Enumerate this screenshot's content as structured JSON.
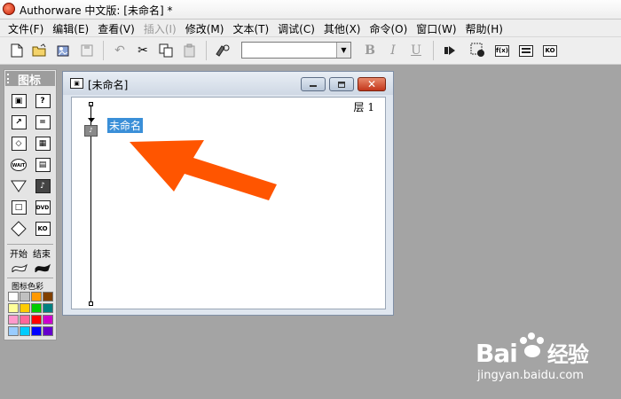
{
  "app": {
    "title": "Authorware 中文版: [未命名] *"
  },
  "menu": [
    {
      "label": "文件(F)",
      "disabled": false
    },
    {
      "label": "编辑(E)",
      "disabled": false
    },
    {
      "label": "查看(V)",
      "disabled": false
    },
    {
      "label": "插入(I)",
      "disabled": true
    },
    {
      "label": "修改(M)",
      "disabled": false
    },
    {
      "label": "文本(T)",
      "disabled": false
    },
    {
      "label": "调试(C)",
      "disabled": false
    },
    {
      "label": "其他(X)",
      "disabled": false
    },
    {
      "label": "命令(O)",
      "disabled": false
    },
    {
      "label": "窗口(W)",
      "disabled": false
    },
    {
      "label": "帮助(H)",
      "disabled": false
    }
  ],
  "toolbar": {
    "font_value": "",
    "bold": "B",
    "italic": "I",
    "underline": "U",
    "func_label": "f(x)",
    "ko_label": "KO"
  },
  "palette": {
    "title": "图标",
    "start_label": "开始",
    "end_label": "结束",
    "color_label": "图标色彩",
    "icons": [
      "display-icon",
      "interaction-icon",
      "motion-icon",
      "calculation-icon",
      "erase-icon",
      "map-icon",
      "wait-icon",
      "movie-icon",
      "navigate-icon",
      "sound-icon",
      "framework-icon",
      "video-icon",
      "decision-icon",
      "knowledge-object-icon"
    ],
    "wait_text": "WAIT",
    "dvd_text": "DVD",
    "ko_text": "KO",
    "colors": [
      "#ffffff",
      "#c0c0c0",
      "#ff9900",
      "#804000",
      "#ffff99",
      "#ffcc00",
      "#00cc00",
      "#008080",
      "#ff99cc",
      "#ff6699",
      "#ff0000",
      "#cc00cc",
      "#99ccff",
      "#00ccff",
      "#0000ff",
      "#6600cc"
    ]
  },
  "window": {
    "title": "[未命名]",
    "layer_label": "层 1",
    "flow_label": "未命名",
    "close_glyph": "✕"
  },
  "annotation": {
    "arrow_color": "#ff5500"
  },
  "watermark": {
    "logo": "Bai",
    "logo_suffix": "经验",
    "url": "jingyan.baidu.com"
  }
}
